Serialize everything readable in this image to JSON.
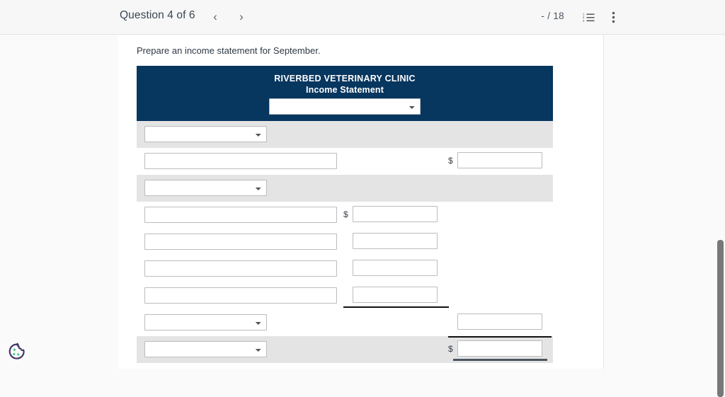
{
  "topbar": {
    "question_label": "Question 4 of 6",
    "prev_icon": "chevron-left-icon",
    "next_icon": "chevron-right-icon",
    "prev_glyph": "‹",
    "next_glyph": "›",
    "score": "- / 18",
    "list_icon": "numbered-list-icon",
    "menu_icon": "more-vertical-icon"
  },
  "content": {
    "prompt": "Prepare an income statement for September."
  },
  "statement": {
    "company_name": "RIVERBED VETERINARY CLINIC",
    "document_title": "Income Statement",
    "header_period_value": "",
    "header_bg_color": "#07365f",
    "shaded_row_color": "#e4e4e4",
    "dollar_symbol": "$",
    "rows": [
      {
        "name": "section-header-row",
        "shaded": true,
        "desc_type": "select",
        "desc_value": "",
        "amount_inner": null,
        "amount_outer": null
      },
      {
        "name": "revenue-line-row",
        "shaded": false,
        "desc_type": "input",
        "desc_value": "",
        "amount_inner": null,
        "amount_outer": {
          "dollar": true,
          "value": ""
        }
      },
      {
        "name": "expenses-header-row",
        "shaded": true,
        "desc_type": "select",
        "desc_value": "",
        "amount_inner": null,
        "amount_outer": null
      },
      {
        "name": "expense-line-row-1",
        "shaded": false,
        "desc_type": "input",
        "desc_value": "",
        "amount_inner": {
          "dollar": true,
          "value": ""
        },
        "amount_outer": null
      },
      {
        "name": "expense-line-row-2",
        "shaded": false,
        "desc_type": "input",
        "desc_value": "",
        "amount_inner": {
          "dollar": false,
          "value": ""
        },
        "amount_outer": null
      },
      {
        "name": "expense-line-row-3",
        "shaded": false,
        "desc_type": "input",
        "desc_value": "",
        "amount_inner": {
          "dollar": false,
          "value": ""
        },
        "amount_outer": null
      },
      {
        "name": "expense-line-row-4",
        "shaded": false,
        "desc_type": "input",
        "desc_value": "",
        "amount_inner": {
          "dollar": false,
          "value": ""
        },
        "amount_outer": null,
        "rule_subtotal": true
      },
      {
        "name": "total-expenses-row",
        "shaded": false,
        "desc_type": "select",
        "desc_value": "",
        "amount_inner": null,
        "amount_outer": {
          "dollar": false,
          "value": ""
        }
      },
      {
        "name": "net-income-row",
        "shaded": true,
        "desc_type": "select",
        "desc_value": "",
        "amount_inner": null,
        "amount_outer": {
          "dollar": true,
          "value": ""
        },
        "rule_total_top": true,
        "rule_total_bottom": true
      }
    ]
  },
  "scrollbar": {
    "name": "page-scrollbar",
    "thumb_color": "#787878"
  },
  "cookie_widget": {
    "name": "cookie-settings-icon",
    "outline_color": "#3d3466",
    "dot_color": "#3ec98a"
  }
}
